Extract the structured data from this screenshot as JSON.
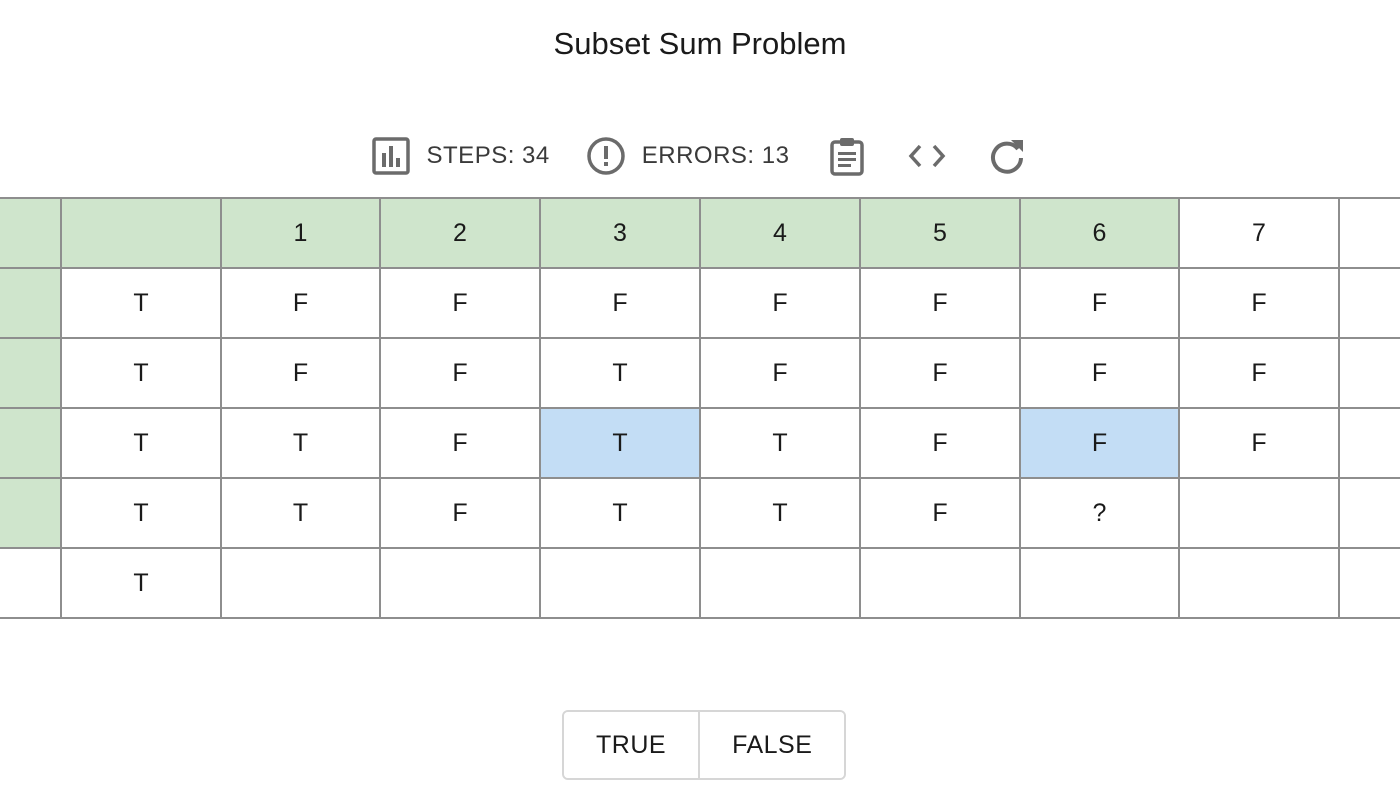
{
  "title": "Subset Sum Problem",
  "toolbar": {
    "steps_label": "STEPS: 34",
    "errors_label": "ERRORS: 13",
    "icons": {
      "steps": "bar-chart-icon",
      "errors": "error-circle-icon",
      "clipboard": "clipboard-icon",
      "code": "code-icon",
      "reset": "refresh-icon"
    }
  },
  "table": {
    "header": [
      "",
      "",
      "1",
      "2",
      "3",
      "4",
      "5",
      "6",
      "7",
      ""
    ],
    "rows": [
      [
        "",
        "T",
        "F",
        "F",
        "F",
        "F",
        "F",
        "F",
        "F",
        ""
      ],
      [
        "",
        "T",
        "F",
        "F",
        "T",
        "F",
        "F",
        "F",
        "F",
        ""
      ],
      [
        "",
        "T",
        "T",
        "F",
        "T",
        "T",
        "F",
        "F",
        "F",
        ""
      ],
      [
        "",
        "T",
        "T",
        "F",
        "T",
        "T",
        "F",
        "?",
        "",
        ""
      ],
      [
        "",
        "T",
        "",
        "",
        "",
        "",
        "",
        "",
        "",
        ""
      ]
    ]
  },
  "answer": {
    "true_label": "TRUE",
    "false_label": "FALSE"
  },
  "colors": {
    "header_fill": "#cfe5cc",
    "highlight_fill": "#c3ddf5",
    "grid_line": "#8e8e8e",
    "icon": "#6b6b6b"
  }
}
